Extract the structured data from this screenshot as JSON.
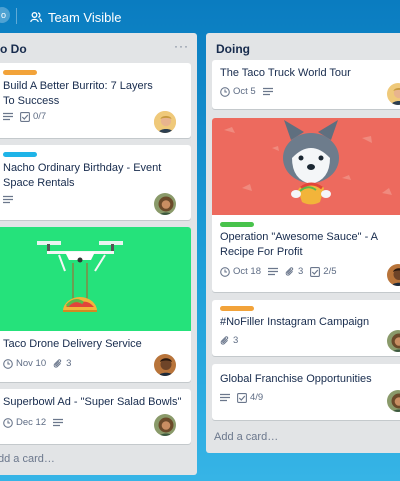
{
  "header": {
    "board_button_text": "o",
    "team_label": "Team Visible"
  },
  "colors": {
    "label_orange": "#f2a33a",
    "label_blue": "#1fb4e8",
    "label_green": "#48c34c",
    "drone_cover_bg": "#25e27b",
    "husky_cover_bg": "#ed6a5e"
  },
  "lists": [
    {
      "title": "o Do",
      "menu": "···",
      "add_card": "dd a card…",
      "cards": [
        {
          "title": "Build A Better Burrito: 7 Layers To Success",
          "label": "orange",
          "has_description": true,
          "checklist": "0/7",
          "avatar": "man-blond"
        },
        {
          "title": "Nacho Ordinary Birthday - Event Space Rentals",
          "label": "blue",
          "has_description": true,
          "avatar": "woman-curly"
        },
        {
          "title": "Taco Drone Delivery Service",
          "cover": "taco-drone",
          "due": "Nov 10",
          "attachments": "3",
          "avatar": "man-dark"
        },
        {
          "title": "Superbowl Ad - \"Super Salad Bowls\"",
          "due": "Dec 12",
          "has_description": true,
          "avatar": "woman-curly"
        }
      ]
    },
    {
      "title": "Doing",
      "add_card": "Add a card…",
      "cards": [
        {
          "title": "The Taco Truck World Tour",
          "due": "Oct 5",
          "has_description": true,
          "avatar": "man-blond"
        },
        {
          "title": "Operation \"Awesome Sauce\" - A Recipe For Profit",
          "cover": "husky-taco",
          "label": "green",
          "due": "Oct 18",
          "has_description": true,
          "attachments": "3",
          "checklist": "2/5",
          "avatar": "man-dark"
        },
        {
          "title": "#NoFiller Instagram Campaign",
          "label": "orange",
          "attachments": "3",
          "avatar": "woman-curly"
        },
        {
          "title": "Global Franchise Opportunities",
          "has_description": true,
          "checklist": "4/9",
          "avatar": "woman-curly"
        }
      ]
    }
  ]
}
